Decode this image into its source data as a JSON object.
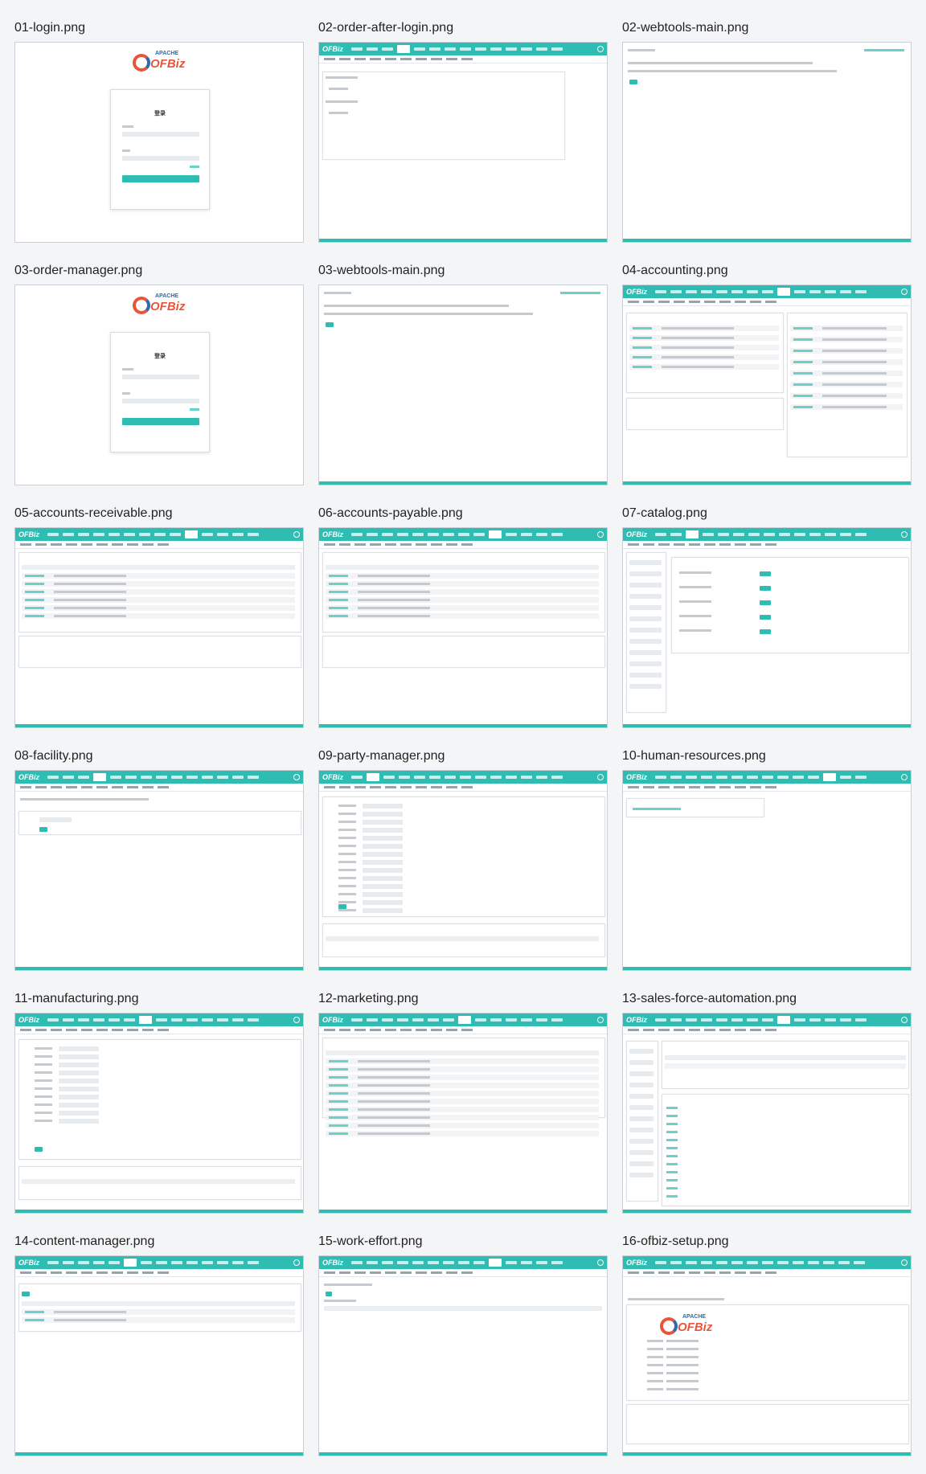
{
  "screenshots": [
    {
      "caption": "01-login.png",
      "kind": "login"
    },
    {
      "caption": "02-order-after-login.png",
      "kind": "order"
    },
    {
      "caption": "02-webtools-main.png",
      "kind": "webtools"
    },
    {
      "caption": "03-order-manager.png",
      "kind": "login"
    },
    {
      "caption": "03-webtools-main.png",
      "kind": "webtools"
    },
    {
      "caption": "04-accounting.png",
      "kind": "accounting"
    },
    {
      "caption": "05-accounts-receivable.png",
      "kind": "table"
    },
    {
      "caption": "06-accounts-payable.png",
      "kind": "table"
    },
    {
      "caption": "07-catalog.png",
      "kind": "catalog"
    },
    {
      "caption": "08-facility.png",
      "kind": "facility"
    },
    {
      "caption": "09-party-manager.png",
      "kind": "form"
    },
    {
      "caption": "10-human-resources.png",
      "kind": "hr"
    },
    {
      "caption": "11-manufacturing.png",
      "kind": "form2"
    },
    {
      "caption": "12-marketing.png",
      "kind": "table2"
    },
    {
      "caption": "13-sales-force-automation.png",
      "kind": "sfa"
    },
    {
      "caption": "14-content-manager.png",
      "kind": "content"
    },
    {
      "caption": "15-work-effort.png",
      "kind": "work"
    },
    {
      "caption": "16-ofbiz-setup.png",
      "kind": "setup"
    }
  ],
  "login": {
    "title": "登录",
    "logo_top": "APACHE",
    "logo_main": "OFBiz"
  },
  "brand": {
    "teal": "#2ebcb3"
  }
}
